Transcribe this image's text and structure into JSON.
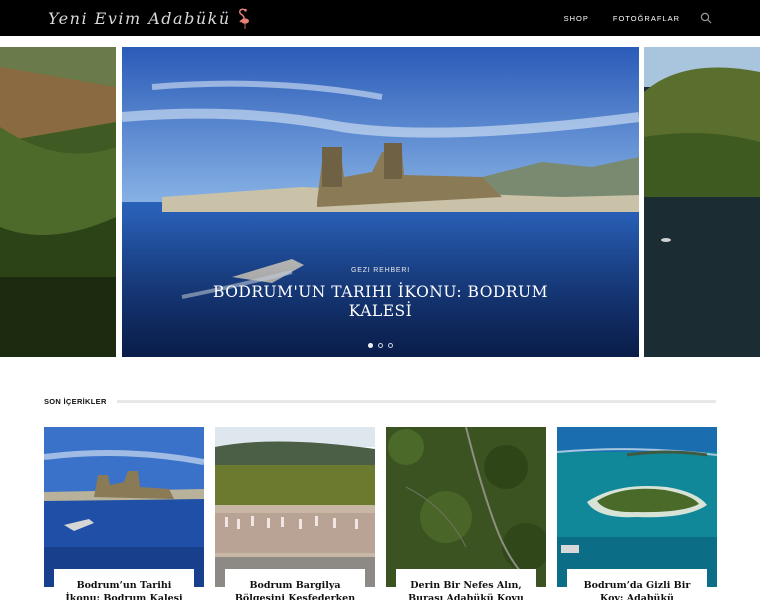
{
  "header": {
    "logo_text": "Yeni Evim Adabükü",
    "nav": [
      {
        "label": "SHOP"
      },
      {
        "label": "FOTOĞRAFLAR"
      }
    ]
  },
  "slider": {
    "category": "GEZI REHBERI",
    "title": "BODRUM'UN TARIHI İKONU: BODRUM KALESİ",
    "dots": [
      {
        "active": true
      },
      {
        "active": false
      },
      {
        "active": false
      }
    ]
  },
  "section": {
    "title": "SON İÇERİKLER"
  },
  "cards": [
    {
      "title": "Bodrum’un Tarihi İkonu: Bodrum Kalesi"
    },
    {
      "title": "Bodrum Bargilya Bölgesini Keşfederken Kuşlar"
    },
    {
      "title": "Derin Bir Nefes Alın, Burası Adabükü Koyu"
    },
    {
      "title": "Bodrum’da Gizli Bir Koy: Adabükü"
    }
  ],
  "colors": {
    "topbar": "#000000",
    "sea": "#1f4fa6",
    "forest": "#3e5a22"
  }
}
